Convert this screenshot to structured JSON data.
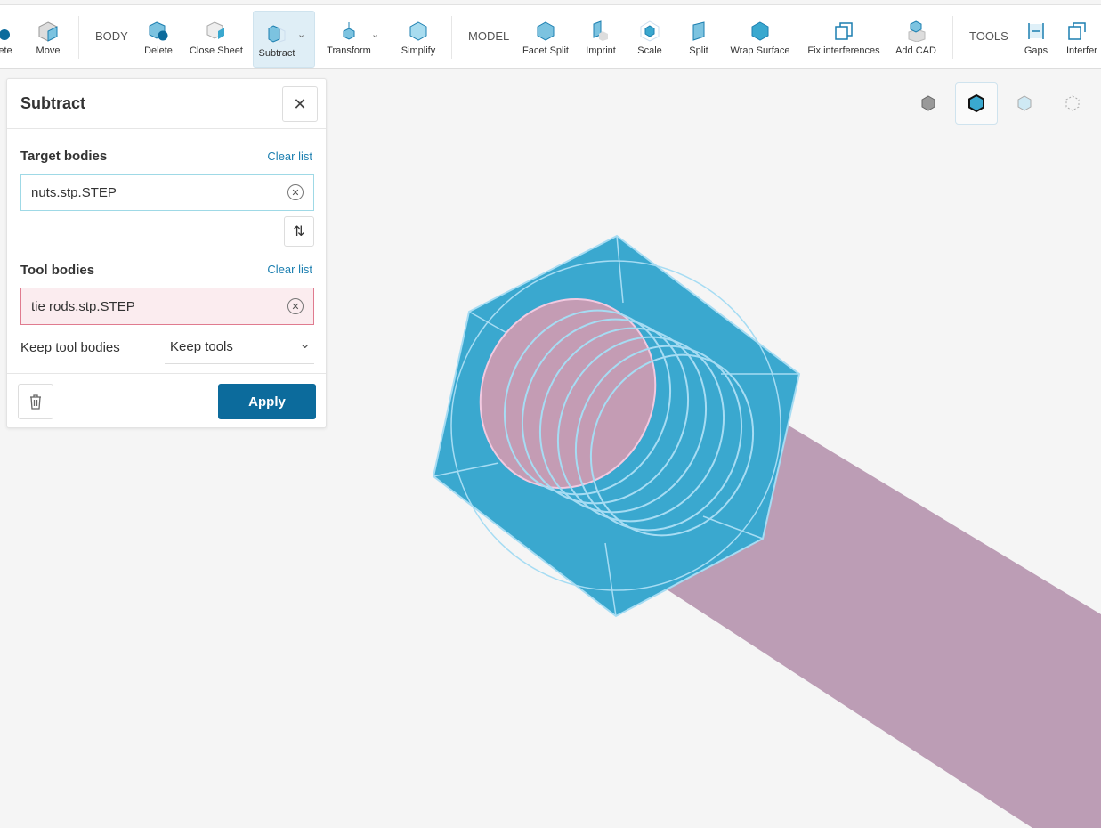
{
  "toolbar": {
    "items": [
      {
        "label": "ete"
      },
      {
        "label": "Move"
      },
      {
        "label": "Delete"
      },
      {
        "label": "Close Sheet"
      },
      {
        "label": "Subtract"
      },
      {
        "label": "Transform"
      },
      {
        "label": "Simplify"
      },
      {
        "label": "Facet Split"
      },
      {
        "label": "Imprint"
      },
      {
        "label": "Scale"
      },
      {
        "label": "Split"
      },
      {
        "label": "Wrap Surface"
      },
      {
        "label": "Fix interferences"
      },
      {
        "label": "Add CAD"
      },
      {
        "label": "Gaps"
      },
      {
        "label": "Interfer"
      }
    ],
    "sections": {
      "body": "BODY",
      "model": "MODEL",
      "tools": "TOOLS"
    }
  },
  "panel": {
    "title": "Subtract",
    "target_label": "Target bodies",
    "target_clear": "Clear list",
    "target_value": "nuts.stp.STEP",
    "tool_label": "Tool bodies",
    "tool_clear": "Clear list",
    "tool_value": "tie rods.stp.STEP",
    "keep_label": "Keep tool bodies",
    "keep_value": "Keep tools",
    "apply": "Apply"
  },
  "colors": {
    "accent": "#0c6b9c",
    "nut": "#3aa8cf",
    "rod": "#bc9db5"
  }
}
